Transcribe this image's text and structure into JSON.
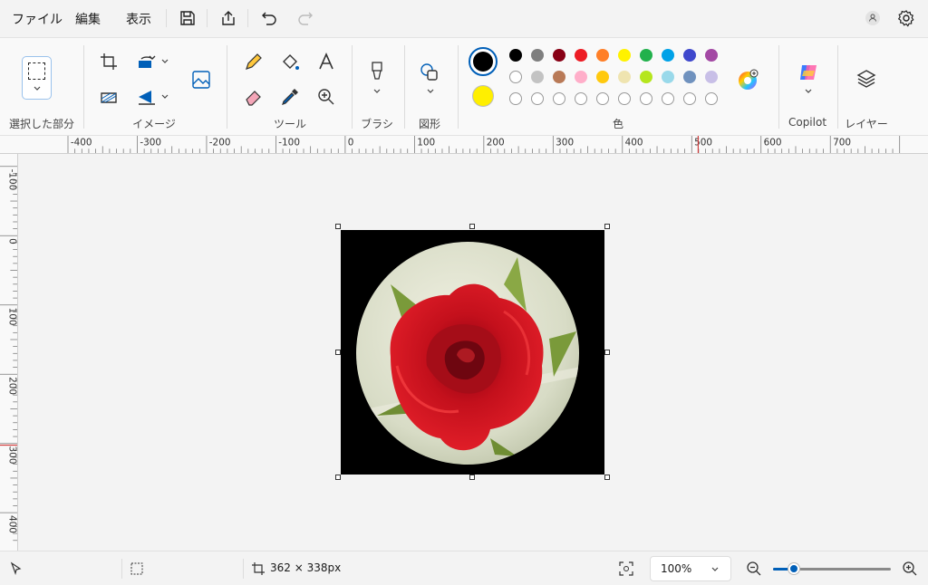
{
  "menu": {
    "file": "ファイル",
    "edit": "編集",
    "view": "表示"
  },
  "groups": {
    "selection": "選択した部分",
    "image": "イメージ",
    "tools": "ツール",
    "brush": "ブラシ",
    "shapes": "図形",
    "colors": "色",
    "copilot": "Copilot",
    "layers": "レイヤー"
  },
  "colors": {
    "primary": "#000000",
    "secondary": "#ffef00",
    "palette_row1": [
      "#000000",
      "#7f7f7f",
      "#880015",
      "#ed1c24",
      "#ff7f27",
      "#fff200",
      "#22b14c",
      "#00a2e8",
      "#3f48cc",
      "#a349a4"
    ],
    "palette_row2": [
      "#ffffff",
      "#c3c3c3",
      "#b97a57",
      "#ffaec9",
      "#ffc90e",
      "#efe4b0",
      "#b5e61d",
      "#99d9ea",
      "#7092be",
      "#c8bfe7"
    ],
    "accent": "#005fb8"
  },
  "ruler": {
    "h_labels": [
      "-400",
      "-300",
      "-200",
      "-100",
      "0",
      "100",
      "200",
      "300",
      "400",
      "500",
      "600",
      "700"
    ],
    "v_labels": [
      "-100",
      "0",
      "100",
      "200",
      "300",
      "400"
    ]
  },
  "status": {
    "dimensions": "362 × 338px",
    "zoom": "100%",
    "zoom_fraction": 0.18
  }
}
